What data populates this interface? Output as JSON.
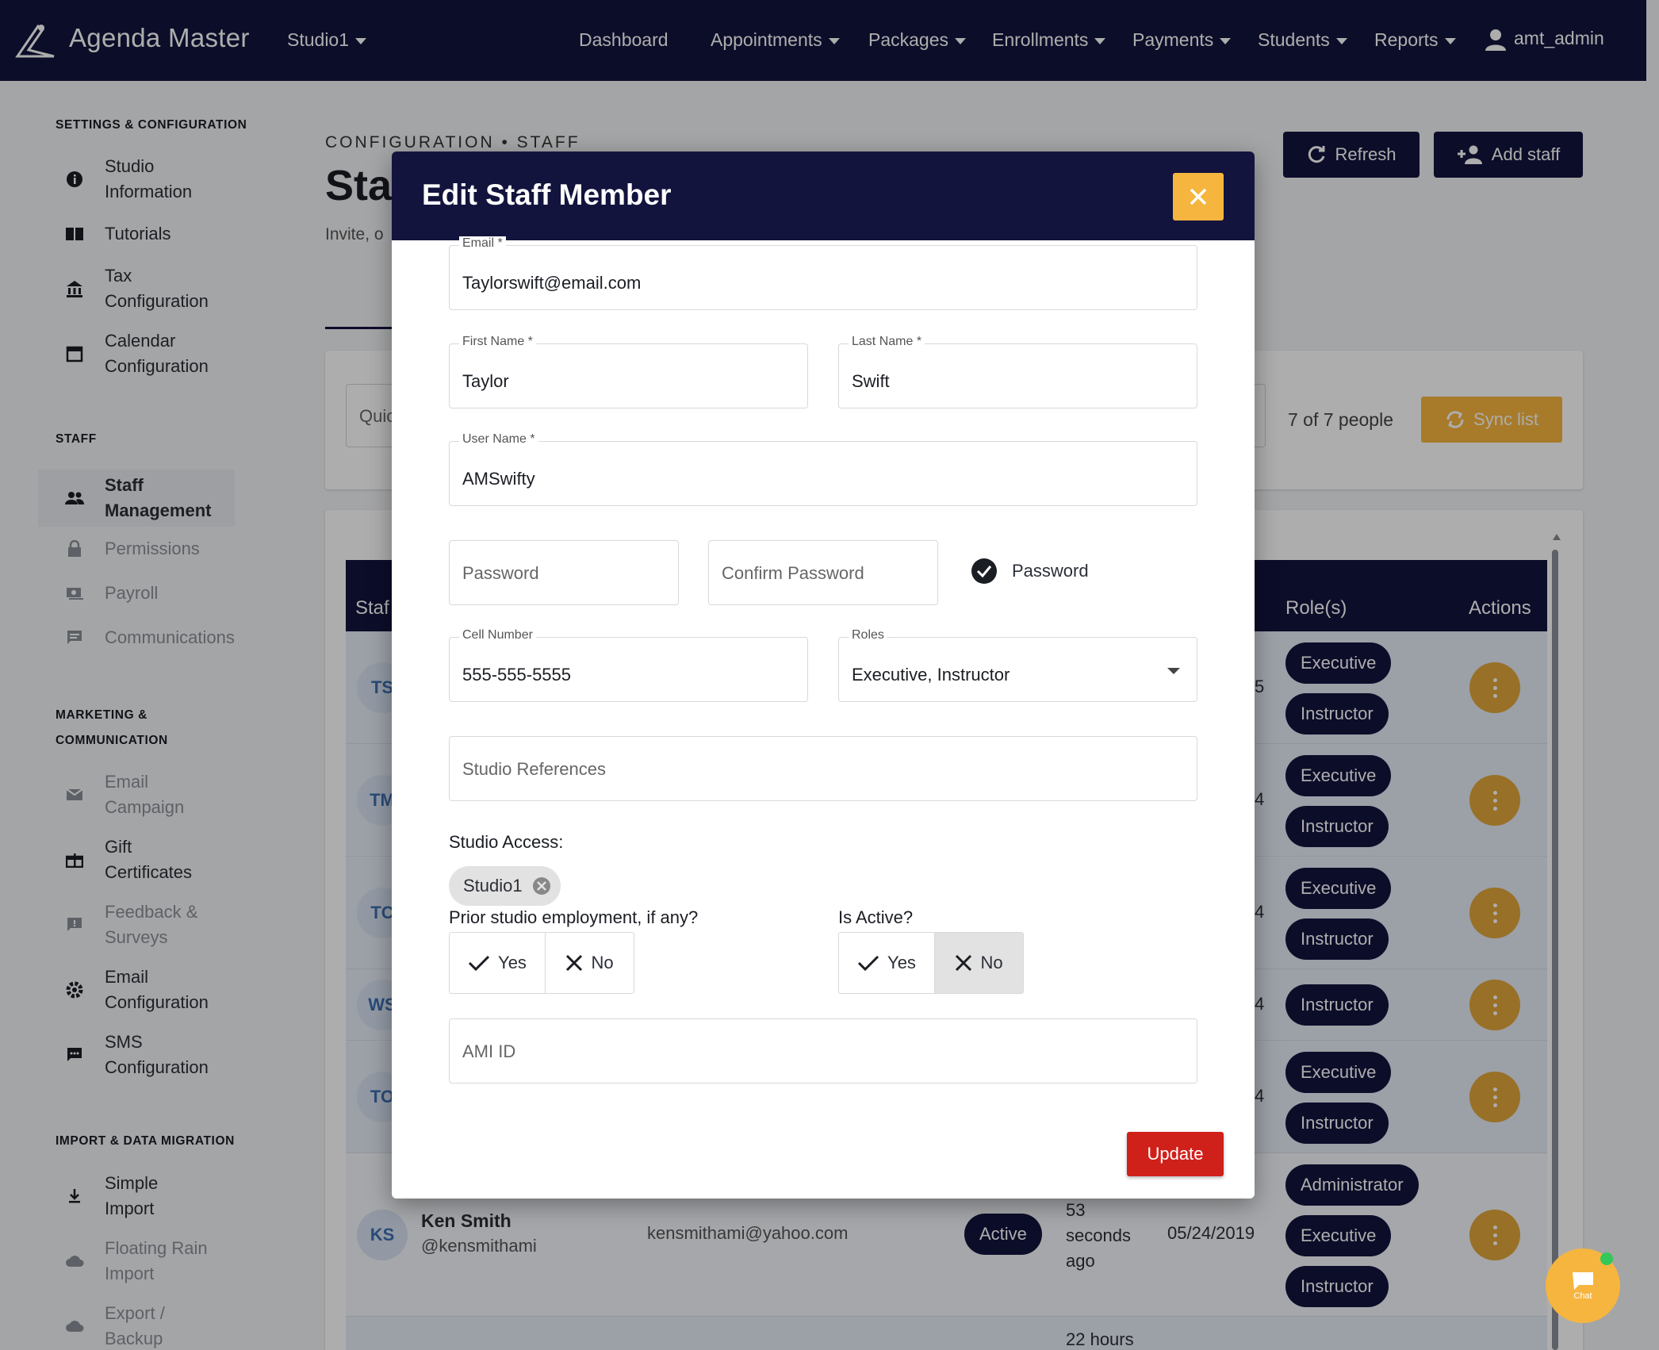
{
  "app": {
    "brand": "Agenda Master",
    "studio": "Studio1",
    "user": "amt_admin"
  },
  "nav": [
    "Dashboard",
    "Appointments",
    "Packages",
    "Enrollments",
    "Payments",
    "Students",
    "Reports"
  ],
  "sidebar": {
    "sections": [
      "SETTINGS & CONFIGURATION",
      "STAFF",
      "MARKETING &",
      "COMMUNICATION",
      "IMPORT & DATA MIGRATION"
    ],
    "items": [
      {
        "l1": "Studio",
        "l2": "Information",
        "icon": "info-icon"
      },
      {
        "l1": "Tutorials",
        "l2": "",
        "icon": "book-icon"
      },
      {
        "l1": "Tax",
        "l2": "Configuration",
        "icon": "bank-icon"
      },
      {
        "l1": "Calendar",
        "l2": "Configuration",
        "icon": "calendar-icon"
      },
      {
        "l1": "Staff",
        "l2": "Management",
        "icon": "people-icon"
      },
      {
        "l1": "Permissions",
        "l2": "",
        "icon": "lock-icon"
      },
      {
        "l1": "Payroll",
        "l2": "",
        "icon": "payroll-icon"
      },
      {
        "l1": "Communications",
        "l2": "",
        "icon": "message-icon"
      },
      {
        "l1": "Email",
        "l2": "Campaign",
        "icon": "mail-icon"
      },
      {
        "l1": "Gift",
        "l2": "Certificates",
        "icon": "gift-icon"
      },
      {
        "l1": "Feedback &",
        "l2": "Surveys",
        "icon": "feedback-icon"
      },
      {
        "l1": "Email",
        "l2": "Configuration",
        "icon": "gear-icon"
      },
      {
        "l1": "SMS",
        "l2": "Configuration",
        "icon": "sms-icon"
      },
      {
        "l1": "Simple",
        "l2": "Import",
        "icon": "download-icon"
      },
      {
        "l1": "Floating Rain",
        "l2": "Import",
        "icon": "cloud-icon"
      },
      {
        "l1": "Export /",
        "l2": "Backup",
        "icon": "cloud-upload-icon"
      }
    ]
  },
  "page": {
    "eyebrow": "CONFIGURATION • STAFF",
    "title": "Staf",
    "subtitle": "Invite, o",
    "refresh": "Refresh",
    "add_staff": "Add staff",
    "quick": "Quic",
    "count": "7 of 7 people",
    "sync": "Sync list",
    "col_staff": "Staf",
    "col_roles": "Role(s)",
    "col_actions": "Actions"
  },
  "rows": [
    {
      "initials": "TS",
      "trail": "5",
      "roles": [
        "Executive",
        "Instructor"
      ]
    },
    {
      "initials": "TM",
      "trail": "4",
      "roles": [
        "Executive",
        "Instructor"
      ]
    },
    {
      "initials": "TC",
      "trail": "4",
      "roles": [
        "Executive",
        "Instructor"
      ]
    },
    {
      "initials": "WS",
      "trail": "4",
      "roles": [
        "Instructor"
      ]
    },
    {
      "initials": "TO",
      "trail": "4",
      "roles": [
        "Executive",
        "Instructor"
      ]
    },
    {
      "initials": "KS",
      "name": "Ken Smith",
      "handle": "@kensmithami",
      "email": "kensmithami@yahoo.com",
      "status": "Active",
      "last_l1": "53",
      "last_l2": "seconds",
      "last_l3": "ago",
      "date": "05/24/2019",
      "roles": [
        "Administrator",
        "Executive",
        "Instructor"
      ]
    },
    {
      "last_l1": "22 hours"
    }
  ],
  "modal": {
    "title": "Edit Staff Member",
    "email_label": "Email *",
    "email": "Taylorswift@email.com",
    "first_label": "First Name *",
    "first": "Taylor",
    "last_label": "Last Name *",
    "last": "Swift",
    "user_label": "User Name *",
    "user": "AMSwifty",
    "password_ph": "Password",
    "confirm_ph": "Confirm Password",
    "password_check": "Password",
    "cell_label": "Cell Number",
    "cell": "555-555-5555",
    "roles_label": "Roles",
    "roles": "Executive, Instructor",
    "refs_ph": "Studio References",
    "access_label": "Studio Access:",
    "access_chip": "Studio1",
    "prior_label": "Prior studio employment, if any?",
    "active_label": "Is Active?",
    "yes": "Yes",
    "no": "No",
    "ami_ph": "AMI ID",
    "update": "Update"
  },
  "chat": {
    "label": "Chat"
  },
  "colors": {
    "navy": "#13143d",
    "gold": "#f6b53e",
    "red": "#d0201a"
  }
}
